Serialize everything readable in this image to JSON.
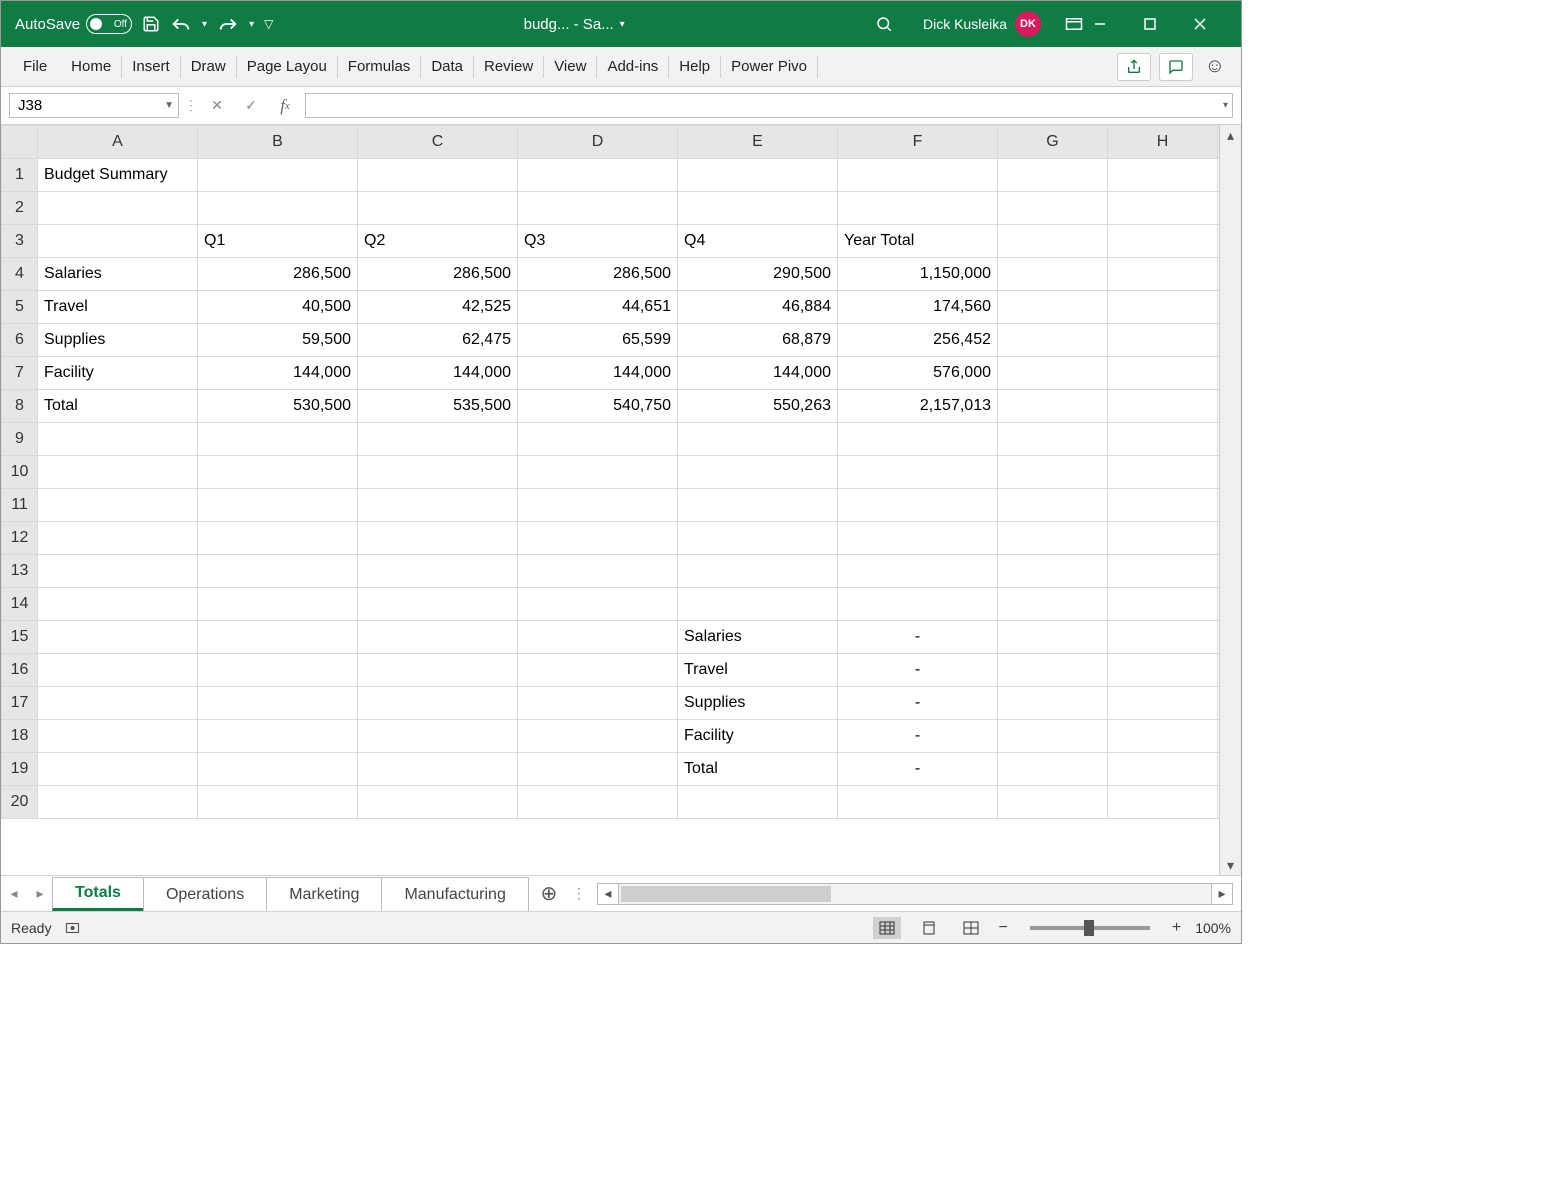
{
  "titlebar": {
    "autosave_label": "AutoSave",
    "autosave_state": "Off",
    "filename": "budg...  -  Sa...",
    "user_name": "Dick Kusleika",
    "user_initials": "DK"
  },
  "ribbon": {
    "tabs": [
      "File",
      "Home",
      "Insert",
      "Draw",
      "Page Layou",
      "Formulas",
      "Data",
      "Review",
      "View",
      "Add-ins",
      "Help",
      "Power Pivo"
    ]
  },
  "formula": {
    "name_box": "J38",
    "value": ""
  },
  "grid": {
    "columns": [
      "A",
      "B",
      "C",
      "D",
      "E",
      "F",
      "G",
      "H",
      ""
    ],
    "rows": [
      {
        "n": "1",
        "cells": {
          "A": "Budget Summary"
        }
      },
      {
        "n": "2",
        "cells": {}
      },
      {
        "n": "3",
        "cells": {
          "B": "Q1",
          "C": "Q2",
          "D": "Q3",
          "E": "Q4",
          "F": "Year Total"
        },
        "left": true
      },
      {
        "n": "4",
        "cells": {
          "A": "Salaries",
          "B": "286,500",
          "C": "286,500",
          "D": "286,500",
          "E": "290,500",
          "F": "1,150,000"
        }
      },
      {
        "n": "5",
        "cells": {
          "A": "Travel",
          "B": "40,500",
          "C": "42,525",
          "D": "44,651",
          "E": "46,884",
          "F": "174,560"
        }
      },
      {
        "n": "6",
        "cells": {
          "A": "Supplies",
          "B": "59,500",
          "C": "62,475",
          "D": "65,599",
          "E": "68,879",
          "F": "256,452"
        }
      },
      {
        "n": "7",
        "cells": {
          "A": "Facility",
          "B": "144,000",
          "C": "144,000",
          "D": "144,000",
          "E": "144,000",
          "F": "576,000"
        }
      },
      {
        "n": "8",
        "cells": {
          "A": "Total",
          "B": "530,500",
          "C": "535,500",
          "D": "540,750",
          "E": "550,263",
          "F": "2,157,013"
        }
      },
      {
        "n": "9",
        "cells": {}
      },
      {
        "n": "10",
        "cells": {}
      },
      {
        "n": "11",
        "cells": {}
      },
      {
        "n": "12",
        "cells": {}
      },
      {
        "n": "13",
        "cells": {}
      },
      {
        "n": "14",
        "cells": {}
      },
      {
        "n": "15",
        "cells": {
          "E": "Salaries",
          "F": "-"
        }
      },
      {
        "n": "16",
        "cells": {
          "E": "Travel",
          "F": "-"
        }
      },
      {
        "n": "17",
        "cells": {
          "E": "Supplies",
          "F": "-"
        }
      },
      {
        "n": "18",
        "cells": {
          "E": "Facility",
          "F": "-"
        }
      },
      {
        "n": "19",
        "cells": {
          "E": "Total",
          "F": "-"
        }
      },
      {
        "n": "20",
        "cells": {}
      }
    ]
  },
  "sheets": {
    "tabs": [
      "Totals",
      "Operations",
      "Marketing",
      "Manufacturing"
    ],
    "active": 0
  },
  "status": {
    "ready": "Ready",
    "zoom": "100%"
  }
}
